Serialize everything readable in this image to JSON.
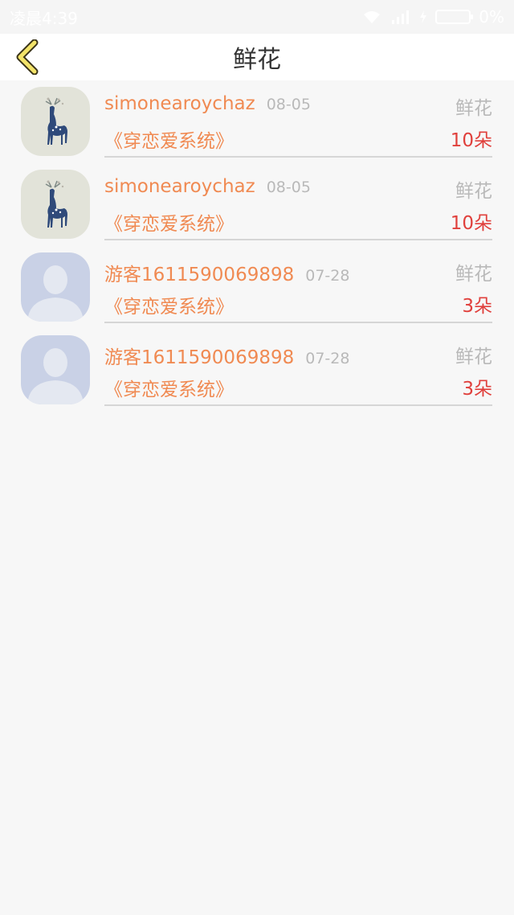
{
  "status_bar": {
    "time": "凌晨4:39",
    "battery_text": "0%",
    "icons": [
      "wifi-icon",
      "signal-icon",
      "charging-icon",
      "battery-icon"
    ]
  },
  "header": {
    "title": "鲜花",
    "back_icon": "chevron-left-icon"
  },
  "items": [
    {
      "avatar": "deer-avatar",
      "name": "simonearoychaz",
      "date": "08-05",
      "book": "《穿恋爱系统》",
      "gift": "鲜花",
      "count": "10朵"
    },
    {
      "avatar": "deer-avatar",
      "name": "simonearoychaz",
      "date": "08-05",
      "book": "《穿恋爱系统》",
      "gift": "鲜花",
      "count": "10朵"
    },
    {
      "avatar": "default-user-avatar",
      "name": "游客1611590069898",
      "date": "07-28",
      "book": "《穿恋爱系统》",
      "gift": "鲜花",
      "count": "3朵"
    },
    {
      "avatar": "default-user-avatar",
      "name": "游客1611590069898",
      "date": "07-28",
      "book": "《穿恋爱系统》",
      "gift": "鲜花",
      "count": "3朵"
    }
  ],
  "colors": {
    "accent_orange": "#f08a52",
    "count_red": "#e0403c",
    "muted_gray": "#b9b9b9",
    "back_icon_yellow": "#f3e46a"
  }
}
